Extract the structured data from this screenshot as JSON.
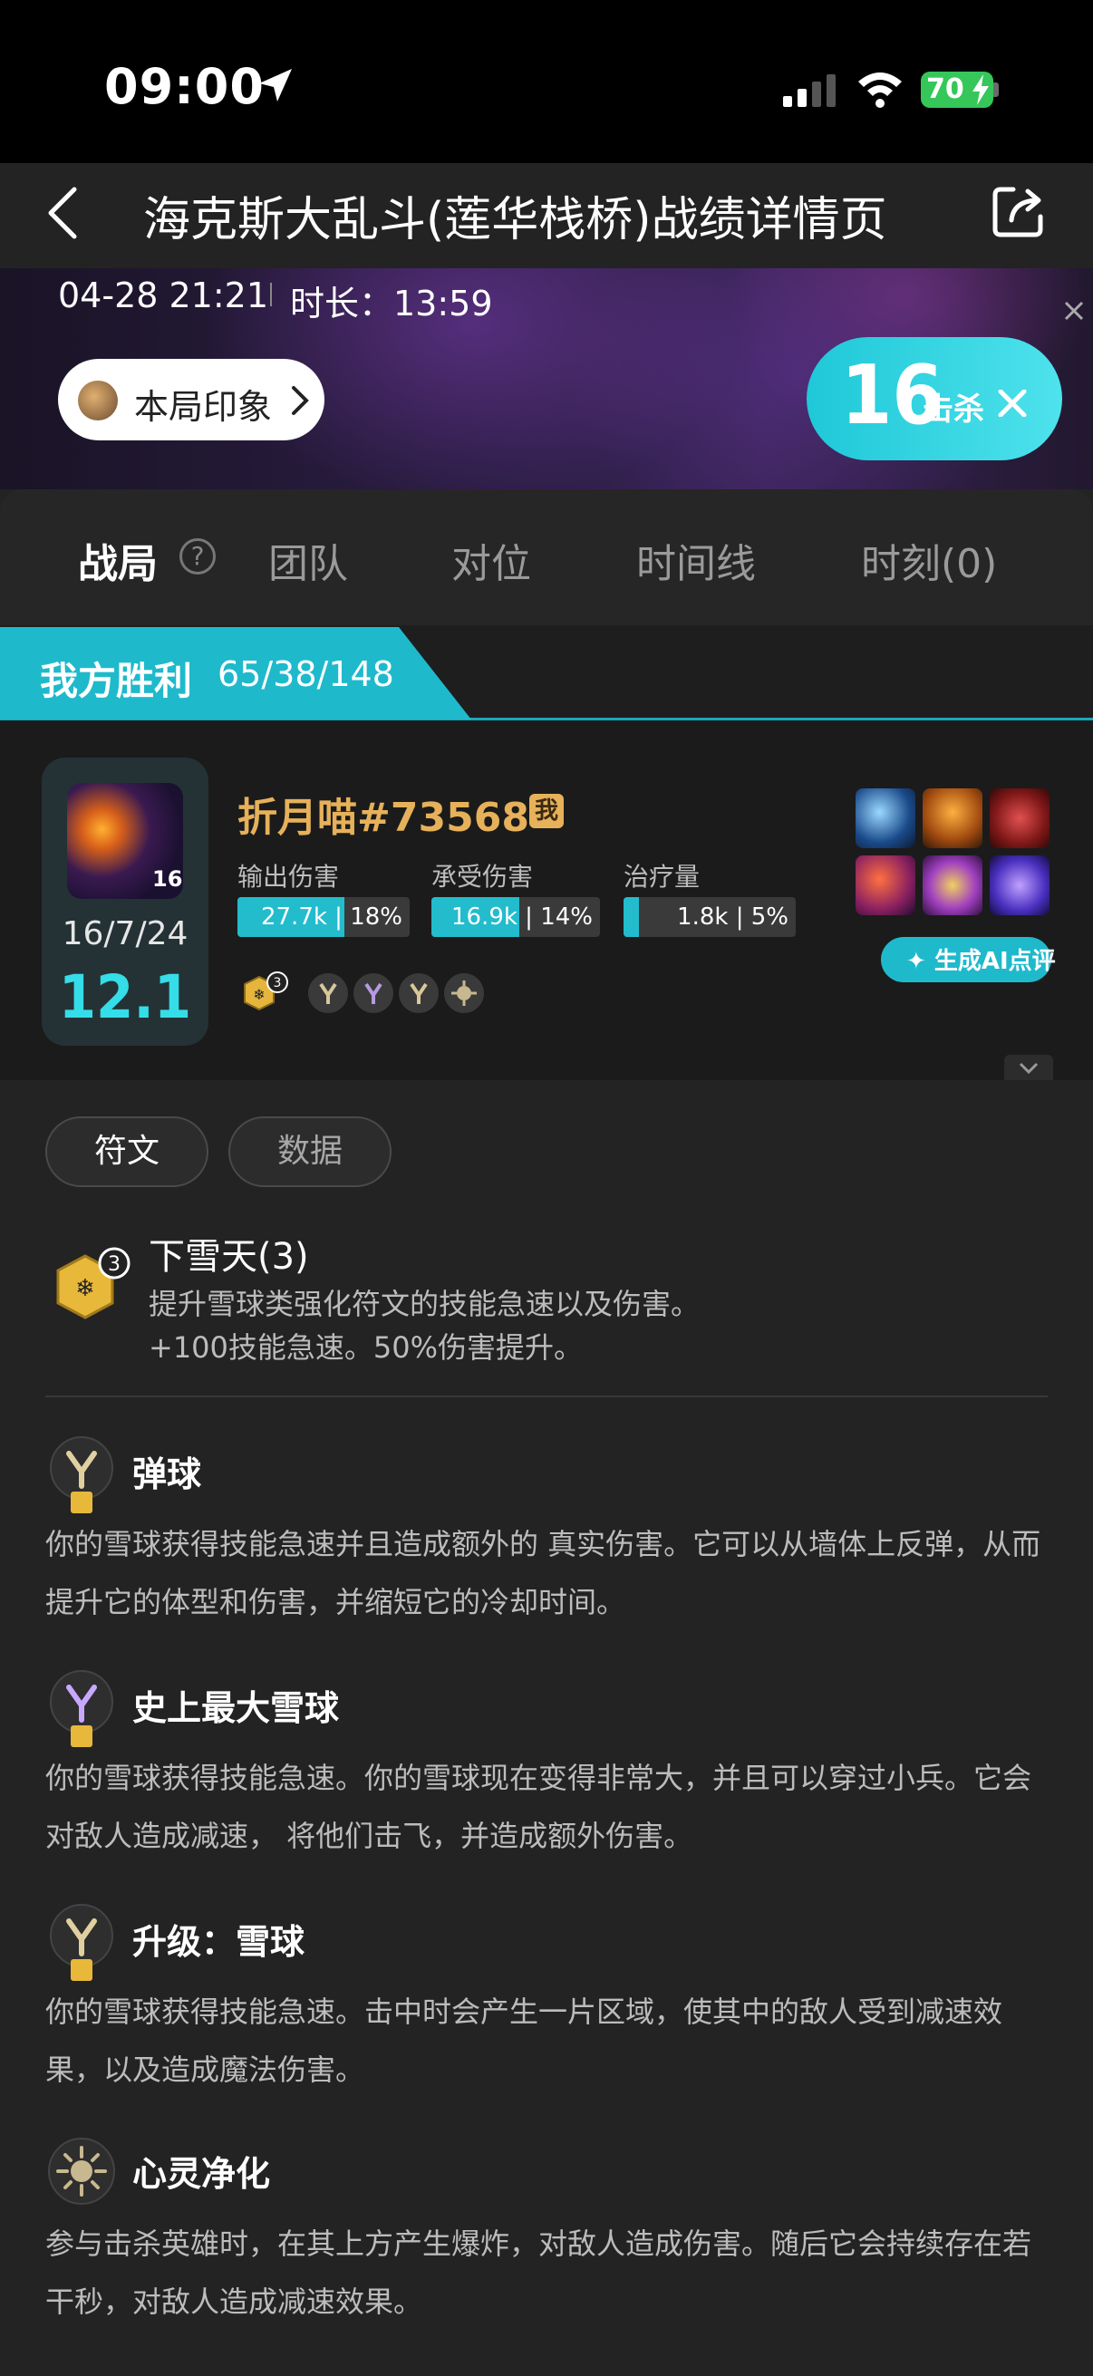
{
  "status_bar": {
    "time": "09:00",
    "battery": "70"
  },
  "nav": {
    "title": "海克斯大乱斗(莲华栈桥)战绩详情页"
  },
  "banner": {
    "date": "04-28 21:21",
    "duration": "时长：13:59",
    "impression_label": "本局印象",
    "kills": "16",
    "kills_label": "击杀"
  },
  "tabs": [
    {
      "label": "战局"
    },
    {
      "label": "团队"
    },
    {
      "label": "对位"
    },
    {
      "label": "时间线"
    },
    {
      "label": "时刻(0)"
    }
  ],
  "team": {
    "result": "我方胜利",
    "score": "65/38/148"
  },
  "player": {
    "name": "折月喵#73568",
    "me_badge": "我",
    "champion_level": "16",
    "kda": "16/7/24",
    "rating": "12.1",
    "stats": [
      {
        "label": "输出伤害",
        "text": "27.7k | 18%",
        "fill": 0.62
      },
      {
        "label": "承受伤害",
        "text": "16.9k | 14%",
        "fill": 0.52
      },
      {
        "label": "治疗量",
        "text": "1.8k | 5%",
        "fill": 0.09
      }
    ],
    "keystone_count": "3",
    "ai_button": "生成AI点评"
  },
  "detail": {
    "pills": [
      {
        "label": "符文"
      },
      {
        "label": "数据"
      }
    ],
    "keystone": {
      "count": "3",
      "title": "下雪天(3)",
      "desc_line1": "提升雪球类强化符文的技能急速以及伤害。",
      "desc_line2": "+100技能急速。50%伤害提升。"
    },
    "augments": [
      {
        "title": "弹球",
        "desc": "你的雪球获得技能急速并且造成额外的 真实伤害。它可以从墙体上反弹，从而提升它的体型和伤害，并缩短它的冷却时间。"
      },
      {
        "title": "史上最大雪球",
        "desc": "你的雪球获得技能急速。你的雪球现在变得非常大，并且可以穿过小兵。它会对敌人造成减速， 将他们击飞，并造成额外伤害。"
      },
      {
        "title": "升级：雪球",
        "desc": "你的雪球获得技能急速。击中时会产生一片区域，使其中的敌人受到减速效果，以及造成魔法伤害。"
      },
      {
        "title": "心灵净化",
        "desc": "参与击杀英雄时，在其上方产生爆炸，对敌人造成伤害。随后它会持续存在若干秒，对敌人造成减速效果。"
      }
    ]
  },
  "colors": {
    "accent": "#1fb9cc",
    "gold": "#e6b15a",
    "rating": "#34dde7"
  }
}
